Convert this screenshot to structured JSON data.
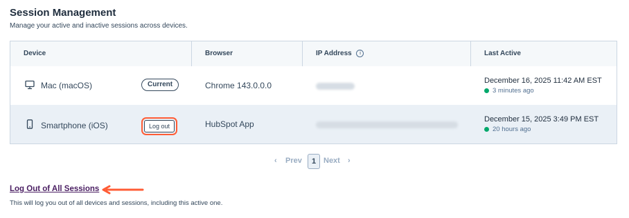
{
  "header": {
    "title": "Session Management",
    "subtitle": "Manage your active and inactive sessions across devices."
  },
  "table": {
    "columns": {
      "device": "Device",
      "browser": "Browser",
      "ip": "IP Address",
      "last_active": "Last Active"
    },
    "rows": [
      {
        "device": "Mac (macOS)",
        "device_icon": "desktop-monitor-icon",
        "action_label": "Current",
        "browser": "Chrome 143.0.0.0",
        "last_active_date": "December 16, 2025 11:42 AM EST",
        "last_active_ago": "3 minutes ago"
      },
      {
        "device": "Smartphone (iOS)",
        "device_icon": "smartphone-icon",
        "action_label": "Log out",
        "browser": "HubSpot App",
        "last_active_date": "December 15, 2025 3:49 PM EST",
        "last_active_ago": "20 hours ago"
      }
    ]
  },
  "pagination": {
    "prev": "Prev",
    "current_page": "1",
    "next": "Next"
  },
  "footer": {
    "logout_all_label": "Log Out of All Sessions",
    "logout_all_note": "This will log you out of all devices and sessions, including this active one."
  },
  "colors": {
    "highlight": "#ff5c35",
    "status_dot": "#00a86b",
    "header_bg": "#f5f8fa",
    "selected_row_bg": "#eaf0f6",
    "link": "#4a1e62"
  }
}
